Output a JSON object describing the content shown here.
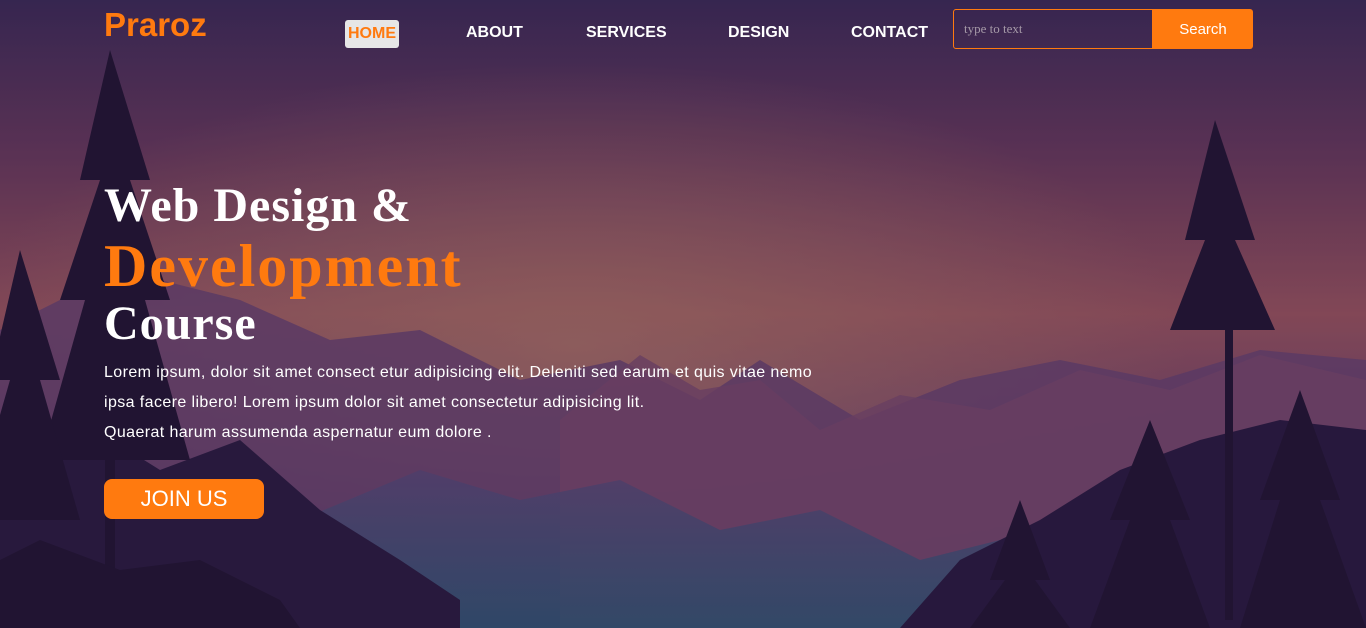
{
  "brand": {
    "name": "Praroz"
  },
  "nav": {
    "items": [
      {
        "label": "HOME",
        "active": true
      },
      {
        "label": "ABOUT"
      },
      {
        "label": "SERVICES"
      },
      {
        "label": "DESIGN"
      },
      {
        "label": "CONTACT"
      }
    ]
  },
  "search": {
    "placeholder": "type to text",
    "value": "",
    "button_label": "Search"
  },
  "hero": {
    "line1": "Web Design &",
    "line2": "Development",
    "line3": "Course",
    "paragraph_lines": [
      "Lorem ipsum, dolor sit amet consect etur adipisicing elit. Deleniti sed earum et quis vitae nemo",
      "ipsa facere libero! Lorem ipsum dolor sit amet consectetur adipisicing lit.",
      "Quaerat harum assumenda aspernatur eum dolore ."
    ],
    "cta_label": "JOIN US"
  },
  "colors": {
    "accent": "#ff7a0f",
    "text": "#ffffff"
  }
}
